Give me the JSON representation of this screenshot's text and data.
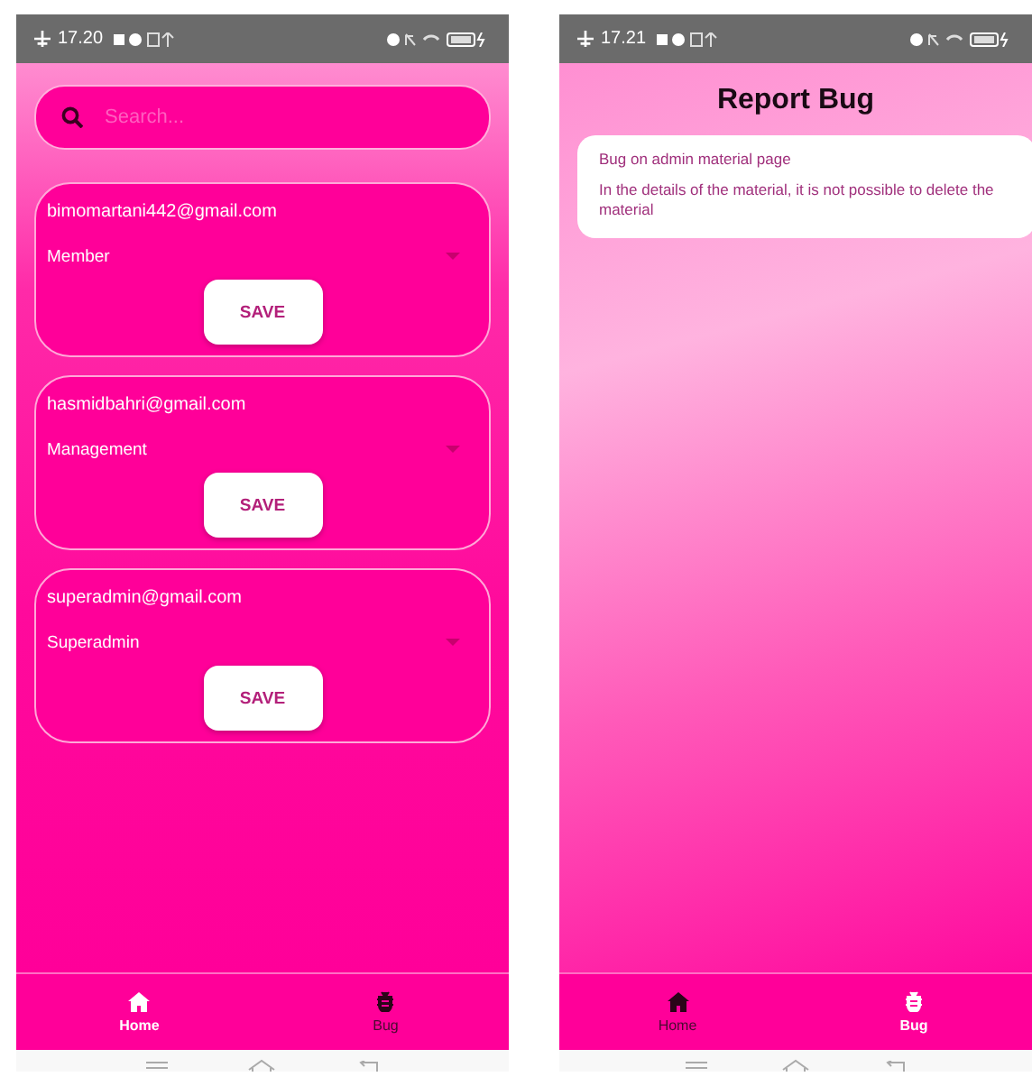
{
  "screens": [
    {
      "kind": "users",
      "status_bar": {
        "time": "17.20"
      },
      "search": {
        "placeholder": "Search..."
      },
      "users": [
        {
          "email": "bimomartani442@gmail.com",
          "role": "Member",
          "button": "SAVE"
        },
        {
          "email": "hasmidbahri@gmail.com",
          "role": "Management",
          "button": "SAVE"
        },
        {
          "email": "superadmin@gmail.com",
          "role": "Superadmin",
          "button": "SAVE"
        }
      ],
      "nav": [
        {
          "label": "Home",
          "kind": "home",
          "selected": true
        },
        {
          "label": "Bug",
          "kind": "bug",
          "selected": false
        }
      ]
    },
    {
      "kind": "report",
      "status_bar": {
        "time": "17.21"
      },
      "title": "Report Bug",
      "bugs": [
        {
          "title": "Bug on admin material page",
          "description": "In the details of the material, it is not possible to delete the material"
        }
      ],
      "nav": [
        {
          "label": "Home",
          "kind": "home",
          "selected": false
        },
        {
          "label": "Bug",
          "kind": "bug",
          "selected": true
        }
      ]
    }
  ]
}
